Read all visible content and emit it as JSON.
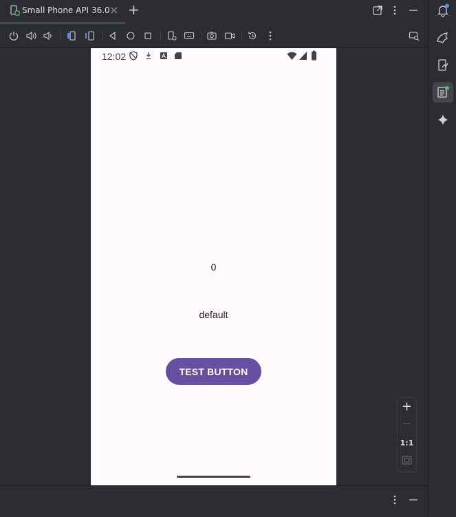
{
  "tab": {
    "label": "Small Phone API 36.0",
    "close_label": "×",
    "new_tab_label": "+"
  },
  "toolbar": {
    "icons": [
      "power-icon",
      "volume-up-icon",
      "volume-down-icon",
      "rotate-left-icon",
      "rotate-right-icon",
      "back-icon",
      "home-icon",
      "overview-icon",
      "device-settings-icon",
      "keyboard-icon",
      "screenshot-icon",
      "screen-record-icon",
      "snapshot-icon",
      "more-icon",
      "device-mirror-icon"
    ]
  },
  "phone": {
    "status_time": "12:02",
    "counter_value": "0",
    "default_text": "default",
    "test_button_label": "TEST BUTTON"
  },
  "zoom": {
    "zoom_in_label": "+",
    "zoom_out_label": "—",
    "actual_size_label": "1:1"
  },
  "colors": {
    "ide_background": "#2b2d30",
    "phone_background": "#fffbfe",
    "button_purple": "#6750a4",
    "accent_blue": "#3574f0"
  }
}
